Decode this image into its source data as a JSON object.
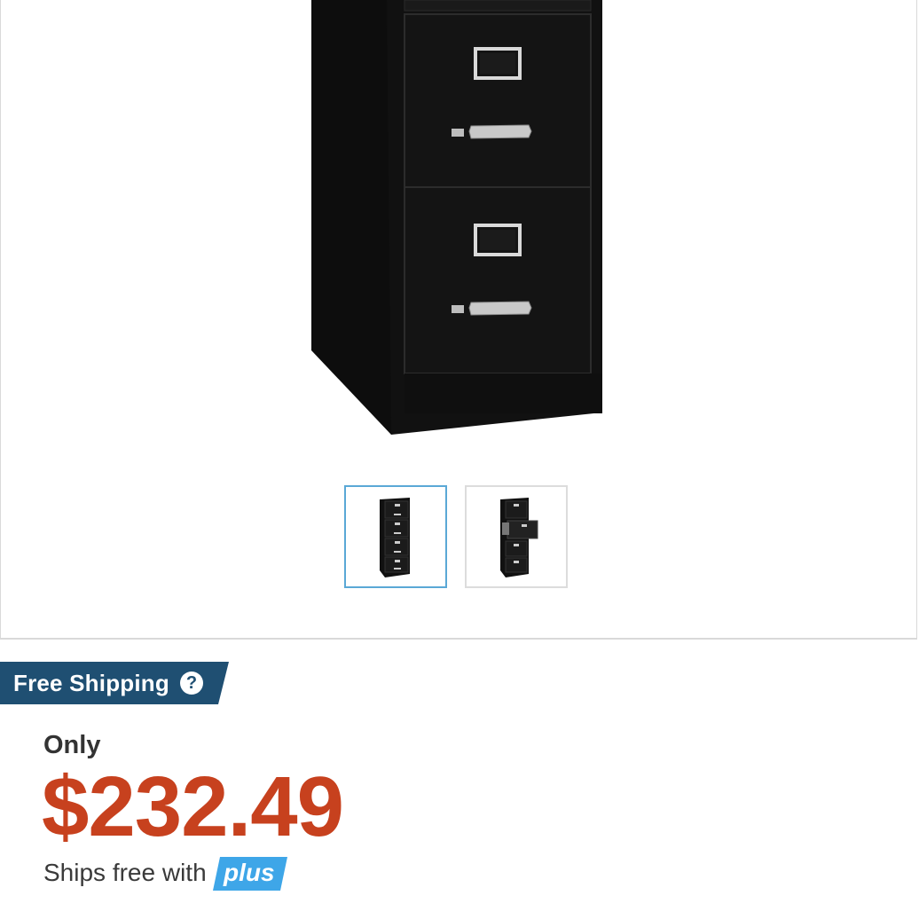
{
  "gallery": {
    "main_image": "black four-drawer vertical file cabinet",
    "thumbnails": [
      {
        "label": "file cabinet front view",
        "selected": true
      },
      {
        "label": "file cabinet with open drawer",
        "selected": false
      }
    ],
    "selected_border_color": "#5aa8d6"
  },
  "shipping": {
    "badge_text": "Free Shipping",
    "help_icon": "?",
    "badge_color": "#1f4f72"
  },
  "pricing": {
    "prefix": "Only",
    "price": "$232.49",
    "price_color": "#c7411e",
    "ships_free_text": "Ships free with",
    "plus_badge": "plus",
    "plus_color": "#3ea6e8"
  }
}
